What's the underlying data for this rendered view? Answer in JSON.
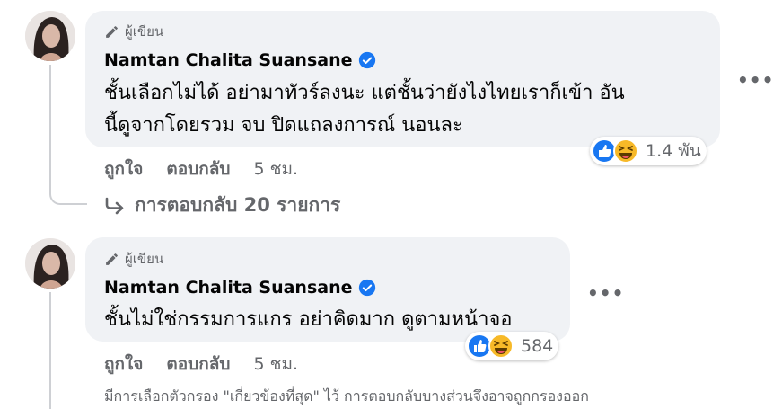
{
  "comments": [
    {
      "author_tag": "ผู้เขียน",
      "author_name": "Namtan Chalita Suansane",
      "text_line1": "ชั้นเลือกไม่ได้ อย่ามาทัวร์ลงนะ แต่ชั้นว่ายังไงไทยเราก็เข้า อัน",
      "text_line2": "นี้ดูจากโดยรวม จบ ปิดแถลงการณ์ นอนละ",
      "reaction_count": "1.4 พัน",
      "like_label": "ถูกใจ",
      "reply_label": "ตอบกลับ",
      "time": "5 ชม.",
      "more_icon": "more-horizontal-icon",
      "replies_link": "การตอบกลับ 20 รายการ"
    },
    {
      "author_tag": "ผู้เขียน",
      "author_name": "Namtan Chalita Suansane",
      "text_line1": "ชั้นไม่ใช่กรรมการแกร อย่าคิดมาก ดูตามหน้าจอ",
      "reaction_count": "584",
      "like_label": "ถูกใจ",
      "reply_label": "ตอบกลับ",
      "time": "5 ชม.",
      "more_icon": "more-horizontal-icon"
    }
  ],
  "filter_notice": "มีการเลือกตัวกรอง \"เกี่ยวข้องที่สุด\" ไว้ การตอบกลับบางส่วนจึงอาจถูกกรองออก",
  "colors": {
    "bubble_bg": "#f0f2f5",
    "verified_blue": "#1877f2",
    "like_blue": "#1877f2",
    "haha_yellow": "#f7b928",
    "muted_text": "#65676b"
  }
}
